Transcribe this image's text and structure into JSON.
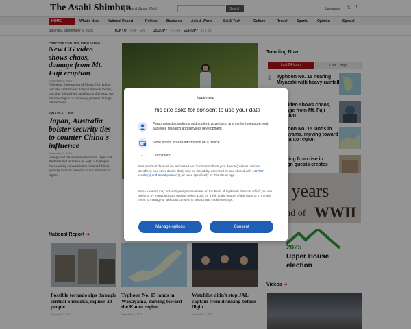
{
  "header": {
    "logo": "The Asahi Shimbun",
    "edition": "Asia & Japan Watch",
    "search_button": "Search",
    "language": "Language",
    "social_x": "𝕏",
    "social_f": "f"
  },
  "nav": {
    "home": "HOME",
    "items": [
      "What's New",
      "National Report",
      "Politics",
      "Business",
      "Asia & World",
      "Sci & Tech",
      "Culture",
      "Travel",
      "Sports",
      "Opinion",
      "Special"
    ]
  },
  "ticker": {
    "date": "Saturday, September 6, 2025",
    "tokyo": "TOKYO",
    "tokyo_val": "PDF · 0%",
    "usdjpy": "USD/JPY",
    "usdjpy_val": "147.44",
    "eurjpy": "EUR/JPY",
    "eurjpy_val": "172.83"
  },
  "left": {
    "a1_kicker": "PREPARE FOR THE INEVITABLE",
    "a1_head": "New CG video shows chaos, damage from Mt. Fuji eruption",
    "a1_date": "September 5, 2025",
    "a1_summary": "Following the eruption of Mount Fuji, falling volcanic ash blankets Tokyo's Shinjuku Ward, blocking the sunlight and forcing drivers to use their headlights to cautiously proceed through intersections.",
    "a2_kicker": "'QUASI-ALLIES'",
    "a2_head": "Japan, Australia bolster security ties to counter China's influence",
    "a2_date": "September 5, 2025",
    "a2_summary": "Foreign and defense ministers from Japan and Australia met in Tokyo on Sept. 5 to deepen their security cooperation to counter China's growing military presence in the Indo-Pacific region."
  },
  "trending": {
    "title": "Trending Now",
    "tab_active": "Last 24 hours",
    "tab_inactive": "Last 7 days",
    "items": [
      {
        "num": "1",
        "text": "Typhoon No. 15 nearing Miyazaki with heavy rainfall"
      },
      {
        "num": "2",
        "text": "CG video shows chaos, damage from Mt. Fuji eruption"
      },
      {
        "num": "3",
        "text": "Typhoon No. 15 lands in Wakayama, moving toward the Kanto region"
      },
      {
        "num": "4",
        "text": "Warning from rise in foreign guests creates"
      }
    ]
  },
  "ad": {
    "years": "80 years",
    "end_of": "end of",
    "wwii": "WWII"
  },
  "election": {
    "year": "2025",
    "line1": "Upper House",
    "line2": "election"
  },
  "national": {
    "title": "National Report",
    "arrow": "➔",
    "cards": [
      {
        "head": "Possible tornado rips through central Shizuoka, injures 20 people",
        "date": "September 5, 2025"
      },
      {
        "head": "Typhoon No. 15 lands in Wakayama, moving toward the Kanto region",
        "date": "September 5, 2025"
      },
      {
        "head": "Watchlist didn't stop JAL captain from drinking before flight",
        "date": "September 5, 2025"
      }
    ]
  },
  "videos": {
    "title": "Videos",
    "arrow": "➔"
  },
  "consent": {
    "welcome": "Welcome",
    "title": "This site asks for consent to use your data",
    "row1": "Personalised advertising and content, advertising and content measurement, audience research and services development",
    "row2": "Store and/or access information on a device",
    "row3": "Learn more",
    "body1_a": "Your personal data will be processed and information from your device (cookies, unique identifiers, and other device data) may be stored by, accessed by and shared with ",
    "body1_link": "142 TCF vendor(s) and 68 ad partner(s)",
    "body1_b": ", or used specifically by this site or app.",
    "body2": "Some vendors may process your personal data on the basis of legitimate interest, which you can object to by managing your options below. Look for a link at the bottom of this page or in the site menu to manage or withdraw consent in privacy and cookie settings.",
    "manage_button": "Manage options",
    "consent_button": "Consent"
  }
}
